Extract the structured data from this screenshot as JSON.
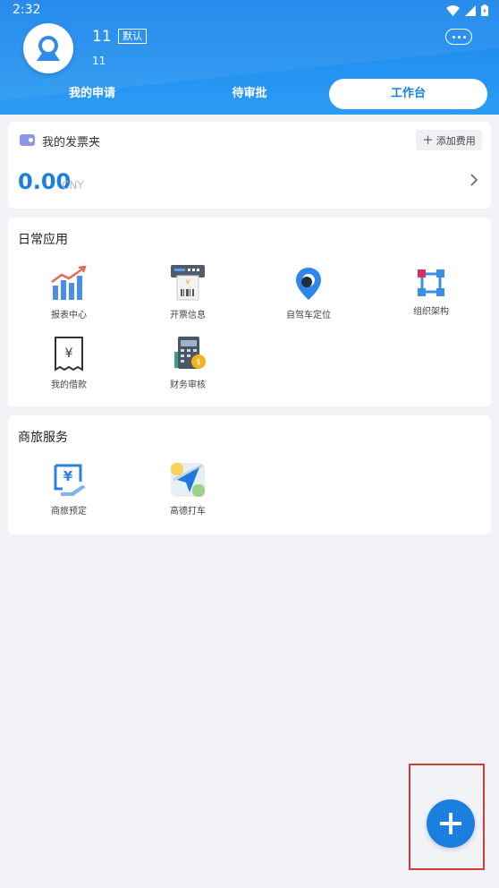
{
  "status_bar": {
    "time": "2:32",
    "icons": [
      "wifi-icon",
      "signal-icon",
      "battery-icon"
    ]
  },
  "profile": {
    "name": "11",
    "default_tag": "默认",
    "subtitle": "11",
    "more_icon": "more-dots-icon"
  },
  "tabs": [
    {
      "label": "我的申请",
      "active": false
    },
    {
      "label": "待审批",
      "active": false
    },
    {
      "label": "工作台",
      "active": true
    }
  ],
  "invoice": {
    "title": "我的发票夹",
    "add_button": "添加费用",
    "amount": "0.00",
    "currency": "CNY"
  },
  "daily_apps": {
    "title": "日常应用",
    "items": [
      {
        "label": "报表中心",
        "icon": "report-chart-icon"
      },
      {
        "label": "开票信息",
        "icon": "invoice-printer-icon"
      },
      {
        "label": "自驾车定位",
        "icon": "location-pin-icon"
      },
      {
        "label": "组织架构",
        "icon": "org-structure-icon"
      },
      {
        "label": "我的借款",
        "icon": "loan-yen-icon"
      },
      {
        "label": "财务审核",
        "icon": "calculator-icon"
      }
    ]
  },
  "travel_services": {
    "title": "商旅服务",
    "items": [
      {
        "label": "商旅预定",
        "icon": "travel-booking-icon"
      },
      {
        "label": "高德打车",
        "icon": "amap-taxi-icon"
      }
    ]
  },
  "fab": {
    "icon": "plus-icon"
  },
  "colors": {
    "primary": "#1b7fe0",
    "header_gradient_start": "#1b84ea",
    "background": "#f2f3f7",
    "highlight": "#d63a3a"
  }
}
